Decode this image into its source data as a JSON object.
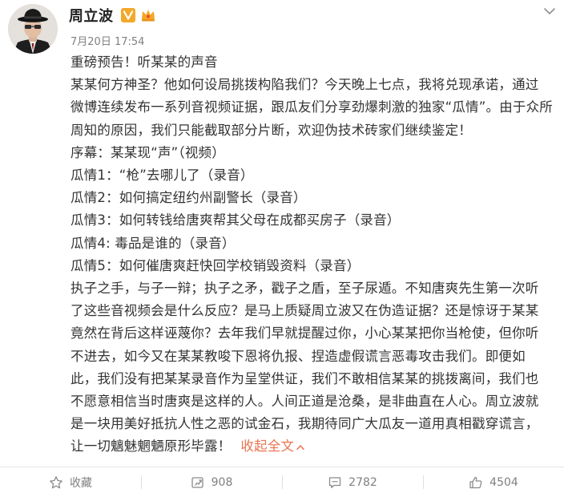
{
  "post": {
    "author": {
      "name": "周立波",
      "verified_badge_icon": "verified-v-badge-icon",
      "member_icon": "crown-member-icon"
    },
    "timestamp": "7月20日 17:54",
    "more_icon": "chevron-down-icon",
    "content": {
      "headline": "重磅预告！听某某的声音",
      "intro_lines": [
        "某某何方神圣？他如何设局挑拨构陷我们？今天晚上七点，我将兑现承诺，通过",
        "微博连续发布一系列音视频证据，跟瓜友们分享劲爆刺激的独家“瓜情”。由于众所",
        "周知的原因，我们只能截取部分片断，欢迎伪技术砖家们继续鉴定！"
      ],
      "episodes": [
        "序幕：某某现“声”（视频）",
        "瓜情1：“枪”去哪儿了（录音）",
        "瓜情2：如何搞定纽约州副警长（录音）",
        "瓜情3：如何转钱给唐爽帮其父母在成都买房子（录音）",
        "瓜情4: 毒品是谁的（录音）",
        "瓜情5：如何催唐爽赶快回学校销毁资料（录音）"
      ],
      "closing_lines": [
        "执子之手，与子一辩；执子之矛，戳子之盾，至子尿遁。不知唐爽先生第一次听",
        "了这些音视频会是什么反应？是马上质疑周立波又在伪造证据？还是惊讶于某某",
        "竟然在背后这样诬蔑你？去年我们早就提醒过你，小心某某把你当枪使，但你听",
        "不进去，如今又在某某教唆下恩将仇报、捏造虚假谎言恶毒攻击我们。即便如",
        "此，我们没有把某某录音作为呈堂供证，我们不敢相信某某的挑拨离间，我们也",
        "不愿意相信当时唐爽是这样的人。人间正道是沧桑，是非曲直在人心。周立波就",
        "是一块用美好抵抗人性之恶的试金石，我期待同广大瓜友一道用真相戳穿谎言，",
        "让一切魑魅魍魉原形毕露！"
      ],
      "collapse_label": "收起全文",
      "collapse_icon": "chevron-up-icon"
    },
    "actions": [
      {
        "name": "favorite",
        "icon": "star-icon",
        "label": "收藏"
      },
      {
        "name": "repost",
        "icon": "repost-icon",
        "label": "908"
      },
      {
        "name": "comment",
        "icon": "comment-icon",
        "label": "2782"
      },
      {
        "name": "like",
        "icon": "thumbs-up-icon",
        "label": "4504"
      }
    ],
    "colors": {
      "link": "#eb7350",
      "verified": "#f2a92b",
      "crown": "#f6a623",
      "muted_text": "#808080"
    }
  }
}
